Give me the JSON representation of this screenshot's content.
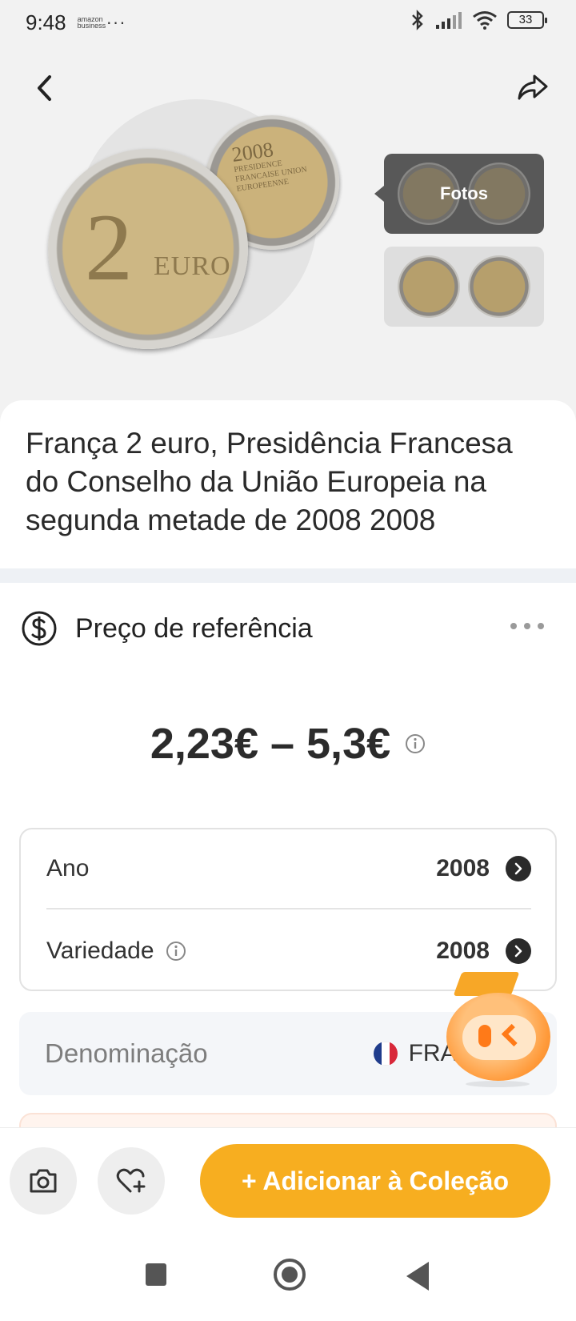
{
  "status_bar": {
    "time": "9:48",
    "app_icon_text": "amazon business",
    "more": "···",
    "battery": "33"
  },
  "header": {
    "back_icon": "chevron-left-icon",
    "share_icon": "share-icon"
  },
  "gallery": {
    "photos_label": "Fotos"
  },
  "coin_images": {
    "front_text_digit": "2",
    "front_text_euro": "EURO",
    "back_text_year": "2008",
    "back_text_body": "PRESIDENCE FRANCAISE UNION EUROPEENNE"
  },
  "item": {
    "title": "França 2 euro, Presidência Francesa do Conselho da União Europeia na segunda metade de 2008 2008"
  },
  "price": {
    "section_title": "Preço de referência",
    "range": "2,23€ – 5,3€"
  },
  "attributes": [
    {
      "label": "Ano",
      "value": "2008"
    },
    {
      "label": "Variedade",
      "value": "2008"
    }
  ],
  "denomination": {
    "label": "Denominação",
    "value": "FRA  2008",
    "flag_colors": [
      "#1f3c8c",
      "#ffffff",
      "#d8283a"
    ]
  },
  "actions": {
    "add_collection_label": "+ Adicionar à Coleção",
    "camera_icon": "camera-icon",
    "wishlist_icon": "heart-plus-icon"
  },
  "colors": {
    "accent": "#f7ae20",
    "mascot": "#ff9a3a"
  }
}
